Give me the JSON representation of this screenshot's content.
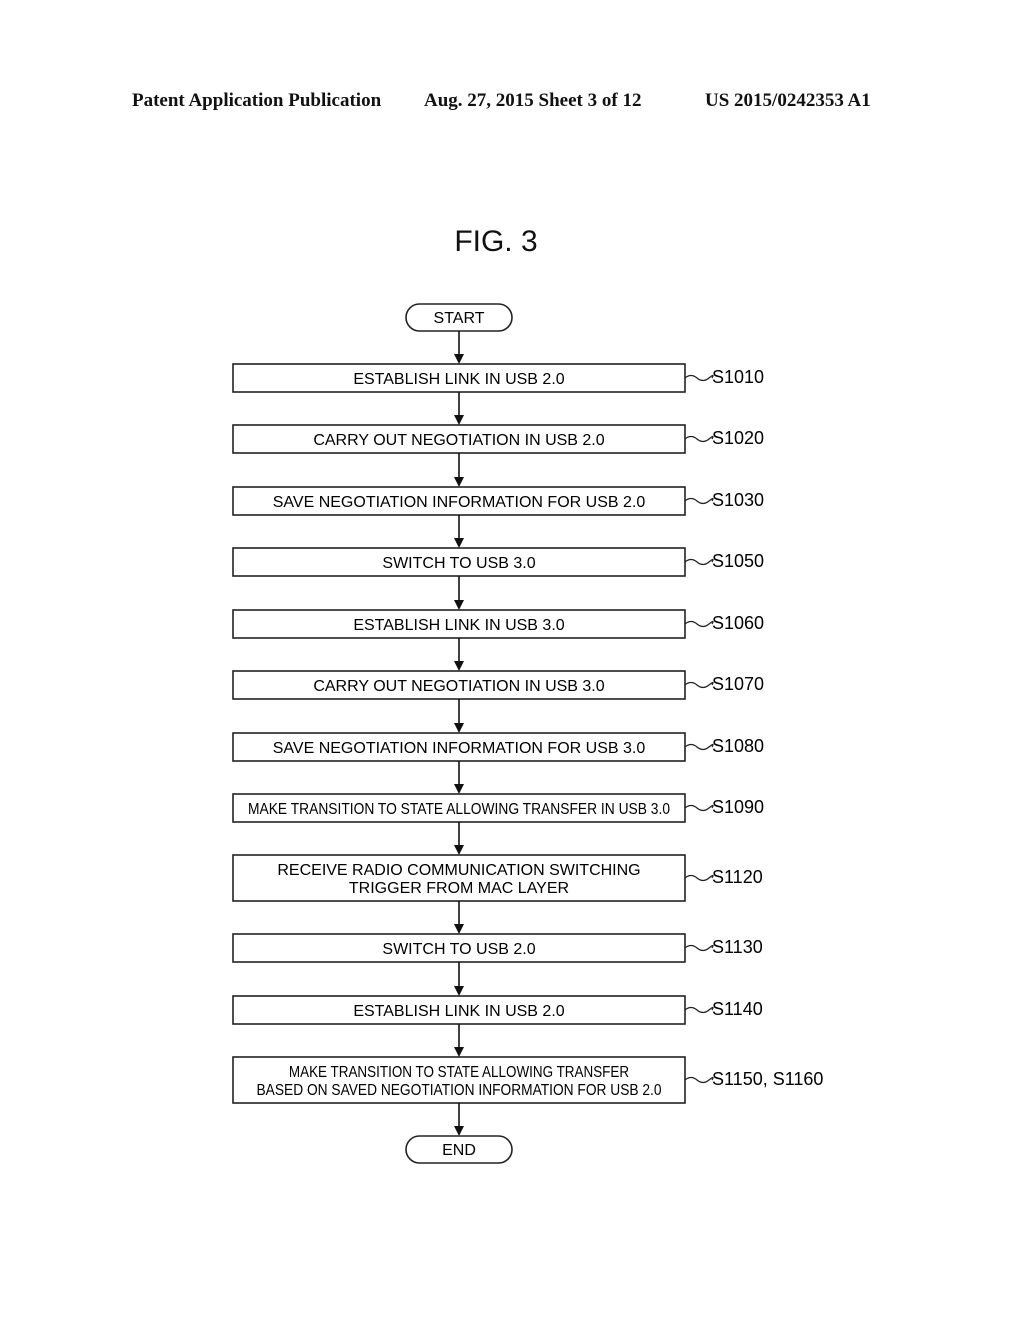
{
  "header": {
    "publication": "Patent Application Publication",
    "date_sheet": "Aug. 27, 2015  Sheet 3 of 12",
    "number": "US 2015/0242353 A1"
  },
  "figure": {
    "title": "FIG. 3"
  },
  "flowchart": {
    "start": "START",
    "end": "END",
    "steps": [
      {
        "lines": [
          "ESTABLISH LINK IN USB 2.0"
        ],
        "label": "S1010"
      },
      {
        "lines": [
          "CARRY OUT NEGOTIATION IN USB 2.0"
        ],
        "label": "S1020"
      },
      {
        "lines": [
          "SAVE NEGOTIATION INFORMATION FOR USB 2.0"
        ],
        "label": "S1030"
      },
      {
        "lines": [
          "SWITCH TO USB 3.0"
        ],
        "label": "S1050"
      },
      {
        "lines": [
          "ESTABLISH LINK IN USB 3.0"
        ],
        "label": "S1060"
      },
      {
        "lines": [
          "CARRY OUT NEGOTIATION IN USB 3.0"
        ],
        "label": "S1070"
      },
      {
        "lines": [
          "SAVE NEGOTIATION INFORMATION FOR USB 3.0"
        ],
        "label": "S1080"
      },
      {
        "lines": [
          "MAKE TRANSITION TO STATE ALLOWING TRANSFER IN USB 3.0"
        ],
        "label": "S1090"
      },
      {
        "lines": [
          "RECEIVE RADIO COMMUNICATION SWITCHING",
          "TRIGGER FROM MAC LAYER"
        ],
        "label": "S1120"
      },
      {
        "lines": [
          "SWITCH TO USB 2.0"
        ],
        "label": "S1130"
      },
      {
        "lines": [
          "ESTABLISH LINK IN USB 2.0"
        ],
        "label": "S1140"
      },
      {
        "lines": [
          "MAKE TRANSITION TO STATE ALLOWING TRANSFER",
          "BASED ON SAVED NEGOTIATION INFORMATION FOR USB 2.0"
        ],
        "label": "S1150, S1160"
      }
    ]
  }
}
